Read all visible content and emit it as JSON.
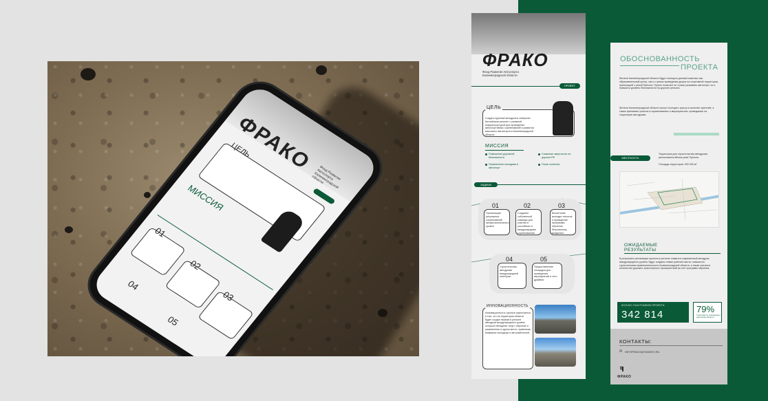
{
  "brand": {
    "logo_text": "ФРАКО",
    "accent_color": "#0a5a38",
    "subtitle": "Фонд Развития Автоспорта Калининградской области"
  },
  "phone_mock": {
    "goal_title": "ЦЕЛЬ",
    "mission_title": "МИССИЯ",
    "task_numbers": [
      "01",
      "02",
      "03",
      "04",
      "05"
    ]
  },
  "page1": {
    "pill_project": "ПРОЕКТ",
    "goal_title": "ЦЕЛЬ",
    "goal_text": "Создать крупный автодром в северном Балтийском регионе с развитой инфраструктурой для проведения автоспортивных соревнований и развития массового автоспорта в Калининградской области.",
    "mission_title": "МИССИЯ",
    "mission_items": [
      "Повышение дорожной безопасности",
      "Снижение смертности на дорогах РФ",
      "Привлечение молодежи в автоспорт",
      "Поиск талантов"
    ],
    "tasks_pill": "ЗАДАЧИ",
    "tasks": [
      {
        "num": "01",
        "text": "Организация регулярных соревнований профессионального уровня"
      },
      {
        "num": "02",
        "text": "Создание собственной команды для участия в российских и международных соревнованиях"
      },
      {
        "num": "03",
        "text": "Воспитание молодых пилотов и проведение программы обучения безопасному вождению"
      },
      {
        "num": "04",
        "text": "Строительство автодрома международной категории"
      },
      {
        "num": "05",
        "text": "Предоставление площадки для проведения мероприятий и тест-драйвов"
      }
    ],
    "innovation_title": "ИННОВАЦИОННОСТЬ",
    "innovation_text": "Инновационность проекта заключается в том, что на территории области будет создан первый в регионе автодром международного уровня, который объединит спорт, обучение и развлечения в одном месте, привлекая внимание молодежи и автолюбителей."
  },
  "page2": {
    "title_line1": "ОБОСНОВАННОСТЬ",
    "title_line2": "ПРОЕКТА",
    "paragraph1": "Жители Калининградской области будут посещать данный комплекс как образовательный центр, так и с целью проведения досуга на спортивной территории, граничащей с рекой Преголя. Проект позволит не только развивать автоспорт, но и повысить уровень безопасности на дорогах региона.",
    "paragraph2": "Жители Калининградской области смогут посещать трассу в качестве зрителей, а также принимать участие в соревнованиях и мероприятиях, проводимых на территории автодрома.",
    "locality_pill": "МЕСТНОСТЬ",
    "locality_text": "Территория для строительства автодрома расположена вблизи реки Преголя.",
    "area_text": "Площадь территории: 900 000 м²",
    "results_title_line1": "ОЖИДАЕМЫЕ",
    "results_title_line2": "РЕЗУЛЬТАТЫ",
    "results_text": "В результате реализации проекта в регионе появится современный автодром международного уровня, будут созданы новые рабочие места, повысится туристическая привлекательность Калининградской области, а также снизится количество дорожно-транспортных происшествий за счет программ обучения.",
    "stat_label": "КОЛ-ВО УЧАСТНИКОВ ПРОЕКТА",
    "stat_value": "342 814",
    "percent_value": "79%",
    "percent_caption": "Участники по отношению к населению области",
    "contacts_title": "КОНТАКТЫ:",
    "email": "INFOFRAKO@YANDEX.RU",
    "footer_logo": "ФРАКО"
  }
}
